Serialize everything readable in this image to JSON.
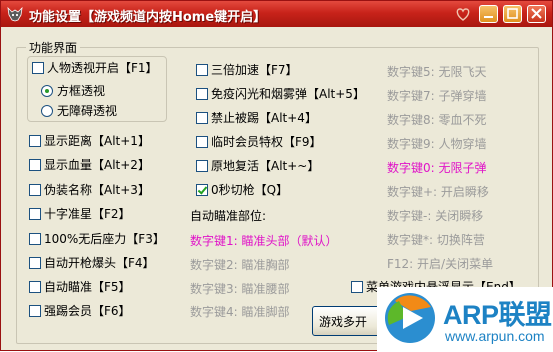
{
  "window": {
    "title": "功能设置【游戏频道内按Home键开启】",
    "colors": {
      "titlebar": "#c8231a",
      "dialog_bg": "#ece9d8",
      "magenta": "#e014c8",
      "gray": "#9b9b9b"
    }
  },
  "group_title": "功能界面",
  "left_column": {
    "esp": "人物透视开启【F1】",
    "radio_box": "方框透视",
    "radio_noobstacle": "无障碍透视",
    "distance": "显示距离【Alt+1】",
    "hp": "显示血量【Alt+2】",
    "disguise": "伪装名称【Alt+3】",
    "crosshair": "十字准星【F2】",
    "no_recoil": "100%无后座力【F3】",
    "auto_headshot": "自动开枪爆头【F4】",
    "auto_aim": "自动瞄准【F5】",
    "kick_member": "强踢会员【F6】"
  },
  "middle_column": {
    "speed": "三倍加速【F7】",
    "no_flash": "免疫闪光和烟雾弹【Alt+5】",
    "no_kick": "禁止被踢【Alt+4】",
    "temp_member": "临时会员特权【F9】",
    "revive": "原地复活【Alt+~】",
    "quick_switch": "0秒切枪【Q】",
    "aim_position_label": "自动瞄准部位:",
    "aim_head": "数字键1: 瞄准头部（默认）",
    "aim_chest": "数字键2: 瞄准胸部",
    "aim_waist": "数字键3: 瞄准腰部",
    "aim_feet": "数字键4: 瞄准脚部"
  },
  "right_column": {
    "k5": "数字键5: 无限飞天",
    "k7": "数字键7: 子弹穿墙",
    "k8": "数字键8: 零血不死",
    "k9": "数字键9: 人物穿墙",
    "k0": "数字键0: 无限子弹",
    "kplus": "数字键+: 开启瞬移",
    "kminus": "数字键-: 关闭瞬移",
    "kstar": "数字键*: 切换阵营",
    "f12": "F12: 开启/关闭菜单",
    "overlay": "菜单游戏内悬浮显示【End】"
  },
  "button_partial": "游戏多开",
  "watermark": {
    "brand": "ARP联盟",
    "url": "www.arpun.com"
  }
}
